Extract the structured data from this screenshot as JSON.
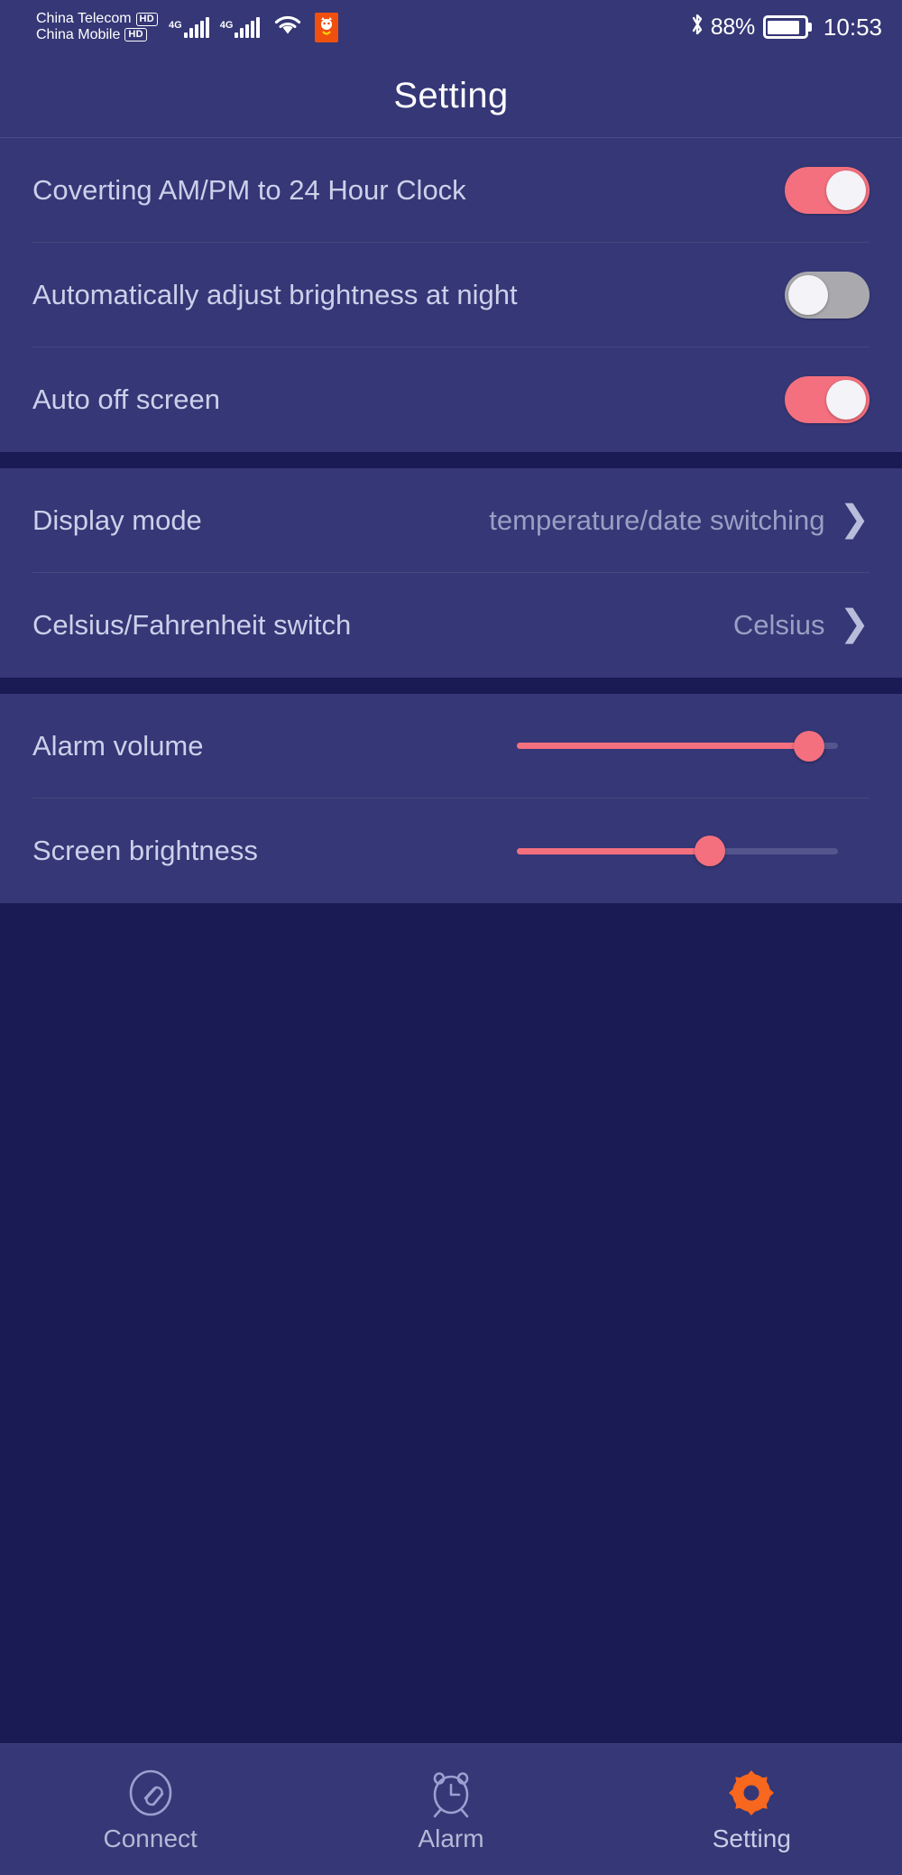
{
  "status_bar": {
    "carriers": [
      {
        "name": "China Telecom",
        "badge": "HD"
      },
      {
        "name": "China Mobile",
        "badge": "HD"
      }
    ],
    "signals": [
      {
        "generation": "4G",
        "bars": 5
      },
      {
        "generation": "4G",
        "bars": 5
      }
    ],
    "wifi_icon": "wifi-icon",
    "app_icon": "notification-app-icon",
    "bluetooth_icon": "bluetooth-icon",
    "battery_percent": "88%",
    "battery_level": 88,
    "battery_icon": "battery-icon",
    "time": "10:53"
  },
  "header": {
    "title": "Setting"
  },
  "sections": [
    {
      "name": "toggles",
      "rows": [
        {
          "label": "Coverting AM/PM to 24 Hour Clock",
          "control": "toggle",
          "state": "on",
          "name": "convert-ampm-24h"
        },
        {
          "label": "Automatically adjust brightness at night",
          "control": "toggle",
          "state": "off",
          "name": "auto-night-brightness"
        },
        {
          "label": "Auto off screen",
          "control": "toggle",
          "state": "on",
          "name": "auto-off-screen"
        }
      ]
    },
    {
      "name": "display-options",
      "rows": [
        {
          "label": "Display mode",
          "control": "nav",
          "value": "temperature/date switching",
          "chevron": "chevron-right-icon",
          "name": "display-mode"
        },
        {
          "label": "Celsius/Fahrenheit switch",
          "control": "nav",
          "value": "Celsius",
          "chevron": "chevron-right-icon",
          "name": "celsius-fahrenheit-switch"
        }
      ]
    },
    {
      "name": "sliders",
      "rows": [
        {
          "label": "Alarm volume",
          "control": "slider",
          "value": 91,
          "name": "alarm-volume"
        },
        {
          "label": "Screen brightness",
          "control": "slider",
          "value": 60,
          "name": "screen-brightness"
        }
      ]
    }
  ],
  "bottom_nav": {
    "items": [
      {
        "label": "Connect",
        "icon": "link-circle-icon",
        "active": false
      },
      {
        "label": "Alarm",
        "icon": "alarm-clock-icon",
        "active": false
      },
      {
        "label": "Setting",
        "icon": "gear-icon",
        "active": true
      }
    ]
  },
  "colors": {
    "background": "#1a1b54",
    "surface": "#353776",
    "accent": "#f4707e",
    "active_nav": "#f7671e",
    "text_primary": "#ccd0ea",
    "text_secondary": "#9a9fc4",
    "toggle_off": "#aaaaae"
  }
}
